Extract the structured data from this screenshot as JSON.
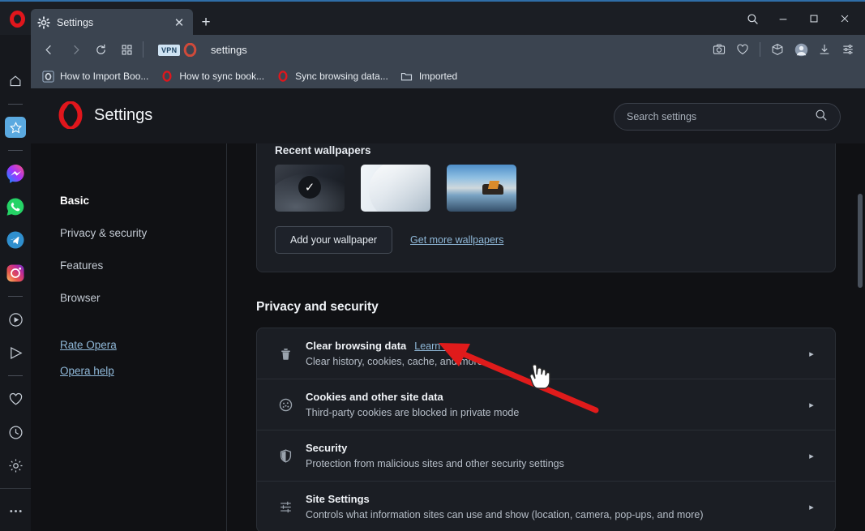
{
  "window": {
    "tab": {
      "title": "Settings",
      "favicon": "gear-icon",
      "close": "✕"
    },
    "new_tab": "+",
    "controls": {
      "search": "search-icon",
      "minimize": "—",
      "maximize": "□",
      "close": "✕"
    }
  },
  "toolbar": {
    "back": "‹",
    "forward": "›",
    "reload": "⟳",
    "tab_gallery": "grid-icon",
    "vpn_badge": "VPN",
    "address_value": "settings",
    "right_icons": [
      "snapshot-icon",
      "heart-icon",
      "cube-icon",
      "avatar-icon",
      "download-icon",
      "easy-setup-icon"
    ]
  },
  "bookmarks": [
    {
      "label": "How to Import Boo...",
      "icon": "opera-page-icon"
    },
    {
      "label": "How to sync book...",
      "icon": "opera-icon"
    },
    {
      "label": "Sync browsing data...",
      "icon": "opera-icon"
    },
    {
      "label": "Imported",
      "icon": "folder-icon"
    }
  ],
  "sidebar": {
    "items": [
      {
        "name": "home",
        "icon": "home-icon",
        "active": false
      },
      {
        "name": "divider-1",
        "icon": "divider",
        "active": false
      },
      {
        "name": "favorites",
        "icon": "star-icon",
        "active": true
      },
      {
        "name": "divider-2",
        "icon": "divider",
        "active": false
      },
      {
        "name": "messenger",
        "icon": "messenger-icon",
        "active": false
      },
      {
        "name": "whatsapp",
        "icon": "whatsapp-icon",
        "active": false
      },
      {
        "name": "telegram",
        "icon": "telegram-icon",
        "active": false
      },
      {
        "name": "instagram",
        "icon": "instagram-icon",
        "active": false
      },
      {
        "name": "divider-3",
        "icon": "divider",
        "active": false
      },
      {
        "name": "player",
        "icon": "play-circle-icon",
        "active": false
      },
      {
        "name": "send",
        "icon": "send-icon",
        "active": false
      },
      {
        "name": "divider-4",
        "icon": "divider",
        "active": false
      },
      {
        "name": "pinboards",
        "icon": "heart-icon",
        "active": false
      },
      {
        "name": "history",
        "icon": "clock-icon",
        "active": false
      },
      {
        "name": "settings",
        "icon": "gear-icon",
        "active": false
      },
      {
        "name": "more",
        "icon": "ellipsis-icon",
        "active": false
      }
    ]
  },
  "settings_header": {
    "logo": "opera-logo-icon",
    "title": "Settings",
    "search": {
      "placeholder": "Search settings",
      "value": "",
      "icon": "search-icon"
    }
  },
  "settings_nav": {
    "items": [
      {
        "label": "Basic",
        "selected": true
      },
      {
        "label": "Privacy & security",
        "selected": false
      },
      {
        "label": "Features",
        "selected": false
      },
      {
        "label": "Browser",
        "selected": false
      }
    ],
    "links": [
      {
        "label": "Rate Opera"
      },
      {
        "label": "Opera help"
      }
    ]
  },
  "wallpapers": {
    "title": "Recent wallpapers",
    "thumbs": [
      {
        "name": "wallpaper-dark-abstract",
        "selected": true,
        "check": "✓"
      },
      {
        "name": "wallpaper-light-abstract",
        "selected": false
      },
      {
        "name": "wallpaper-mountain-lake",
        "selected": false
      }
    ],
    "add_button": "Add your wallpaper",
    "get_more_link": "Get more wallpapers"
  },
  "privacy_section": {
    "title": "Privacy and security",
    "rows": [
      {
        "icon": "trash-icon",
        "title": "Clear browsing data",
        "link": "Learn more",
        "subtitle": "Clear history, cookies, cache, and more",
        "arrow": "▸"
      },
      {
        "icon": "cookie-icon",
        "title": "Cookies and other site data",
        "link": "",
        "subtitle": "Third-party cookies are blocked in private mode",
        "arrow": "▸"
      },
      {
        "icon": "shield-icon",
        "title": "Security",
        "link": "",
        "subtitle": "Protection from malicious sites and other security settings",
        "arrow": "▸"
      },
      {
        "icon": "sliders-icon",
        "title": "Site Settings",
        "link": "",
        "subtitle": "Controls what information sites can use and show (location, camera, pop-ups, and more)",
        "arrow": "▸"
      }
    ]
  },
  "annotation": {
    "arrow_color": "#e01b1b",
    "cursor": "pointer-hand-cursor"
  },
  "colors": {
    "accent_blue": "#5aa9e0",
    "link_blue": "#8fb8d8",
    "chrome_bg": "#3b4450",
    "page_bg": "#101114",
    "card_bg": "#1b1e24",
    "opera_red": "#e0161c"
  }
}
